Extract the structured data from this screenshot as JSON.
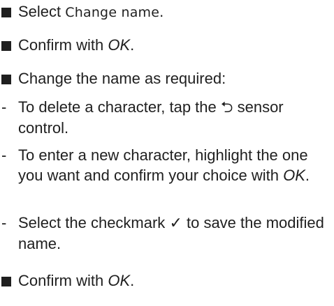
{
  "steps": [
    {
      "type": "bullet",
      "pre": "Select ",
      "display": "Change name",
      "post": "."
    },
    {
      "type": "bullet",
      "pre": "Confirm with ",
      "em": "OK",
      "post": "."
    },
    {
      "type": "bullet",
      "text": "Change the name as required:"
    },
    {
      "type": "dash",
      "marker": "-",
      "pre": "To delete a character, tap the ",
      "symbol": "⮌",
      "post": " sensor control."
    },
    {
      "type": "dash",
      "marker": "-",
      "pre": "To enter a new character, highlight the one you want and confirm your choice with ",
      "em": "OK",
      "post": "."
    },
    {
      "type": "dash",
      "marker": "-",
      "pre": "Select the checkmark ",
      "symbol": "✓",
      "post": " to save the modified name."
    },
    {
      "type": "bullet",
      "pre": "Confirm with ",
      "em": "OK",
      "post": "."
    }
  ],
  "icons": {
    "bullet": "square-bullet-icon",
    "back": "back-arrow-icon",
    "check": "checkmark-icon"
  }
}
